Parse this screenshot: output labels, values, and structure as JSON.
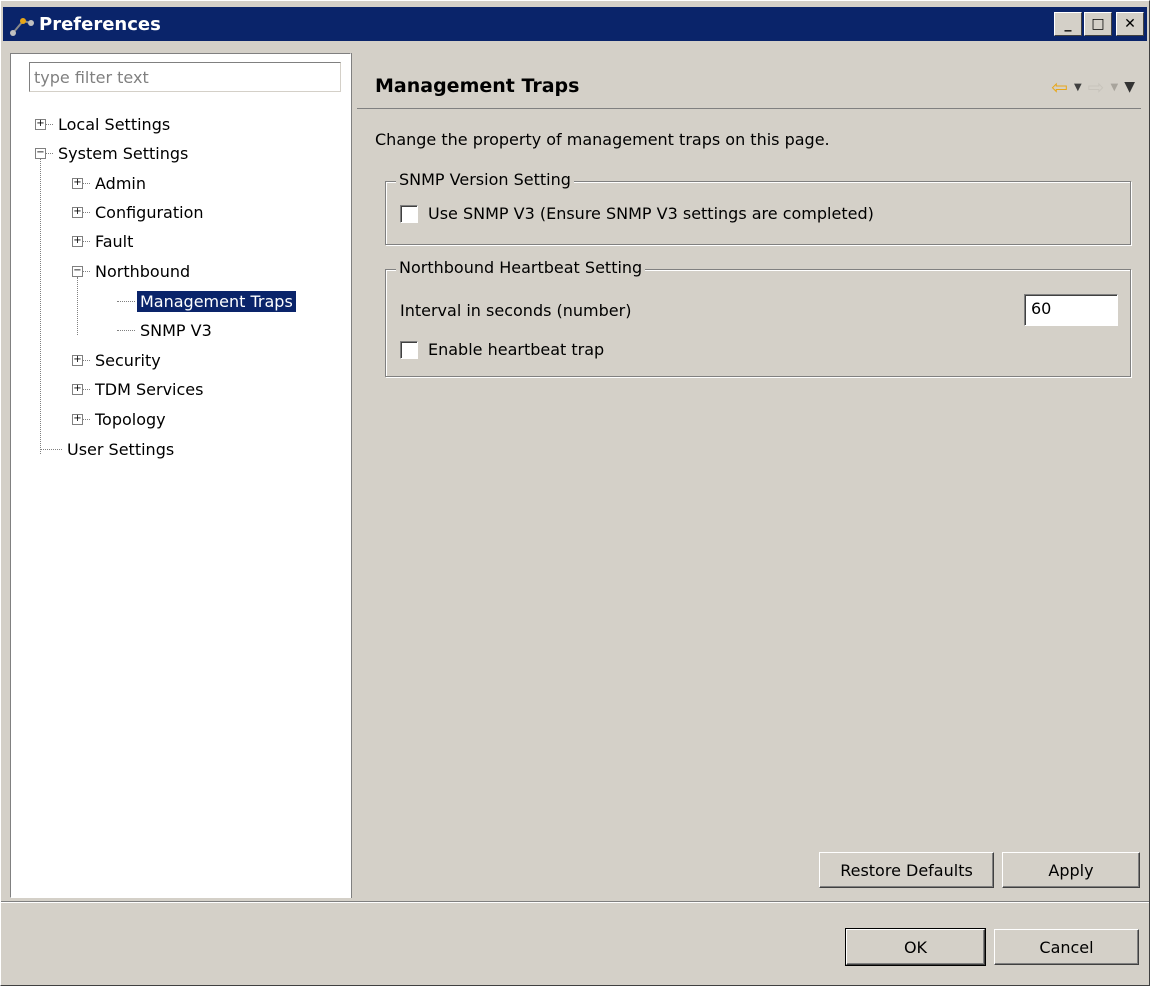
{
  "window": {
    "title": "Preferences",
    "minimize_glyph": "_",
    "maximize_glyph": "□",
    "close_glyph": "✕"
  },
  "filter": {
    "placeholder": "type filter text",
    "value": ""
  },
  "tree": {
    "expand_glyph": "+",
    "collapse_glyph": "−",
    "items": [
      {
        "label": "Local Settings",
        "state": "collapsed"
      },
      {
        "label": "System Settings",
        "state": "expanded"
      },
      {
        "label": "Admin",
        "state": "collapsed"
      },
      {
        "label": "Configuration",
        "state": "collapsed"
      },
      {
        "label": "Fault",
        "state": "collapsed"
      },
      {
        "label": "Northbound",
        "state": "expanded"
      },
      {
        "label": "Management Traps",
        "state": "leaf",
        "selected": true
      },
      {
        "label": "SNMP V3",
        "state": "leaf"
      },
      {
        "label": "Security",
        "state": "collapsed"
      },
      {
        "label": "TDM Services",
        "state": "collapsed"
      },
      {
        "label": "Topology",
        "state": "collapsed"
      },
      {
        "label": "User Settings",
        "state": "leaf"
      }
    ]
  },
  "page": {
    "title": "Management Traps",
    "description": "Change the property of management traps on this page.",
    "nav": {
      "back_icon": "back-arrow-icon",
      "forward_icon": "forward-arrow-icon",
      "menu_icon": "view-menu-icon"
    }
  },
  "snmp_group": {
    "legend": "SNMP Version Setting",
    "use_v3_label": "Use SNMP V3 (Ensure SNMP V3 settings are completed)",
    "use_v3_checked": false
  },
  "heartbeat_group": {
    "legend": "Northbound Heartbeat Setting",
    "interval_label": "Interval in seconds (number)",
    "interval_value": "60",
    "enable_label": "Enable heartbeat trap",
    "enable_checked": false
  },
  "buttons": {
    "restore_defaults": "Restore Defaults",
    "apply": "Apply",
    "ok": "OK",
    "cancel": "Cancel"
  },
  "colors": {
    "titlebar": "#0a246a",
    "selection": "#0a246a",
    "dialog_bg": "#d4d0c8",
    "back_arrow": "#e8a617"
  }
}
